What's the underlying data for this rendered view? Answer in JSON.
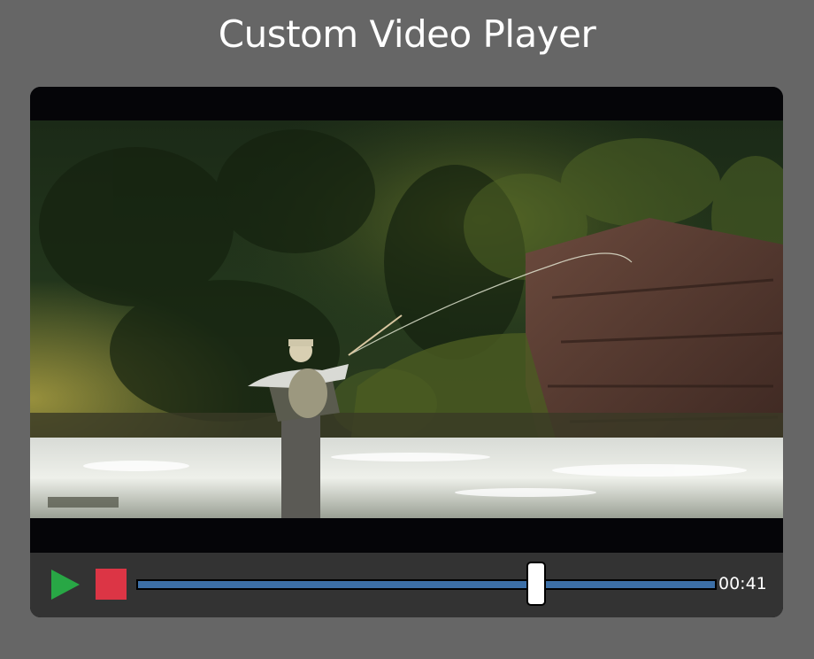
{
  "page": {
    "title": "Custom Video Player"
  },
  "player": {
    "controls": {
      "play_icon": "play-icon",
      "stop_icon": "stop-icon",
      "progress_fraction": 0.69,
      "time": "00:41",
      "colors": {
        "play": "#28a745",
        "stop": "#dc3545",
        "track": "#3c6fa7",
        "controls_bg": "#333333"
      }
    }
  }
}
